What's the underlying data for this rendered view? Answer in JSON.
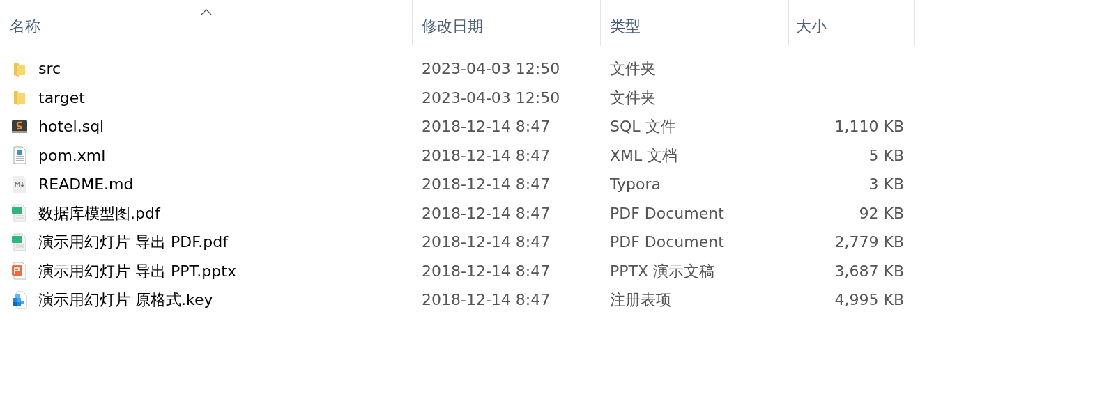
{
  "columns": [
    {
      "label": "名称",
      "sorted": true
    },
    {
      "label": "修改日期",
      "sorted": false
    },
    {
      "label": "类型",
      "sorted": false
    },
    {
      "label": "大小",
      "sorted": false
    }
  ],
  "rows": [
    {
      "kind": "folder",
      "name": "src",
      "modified": "2023-04-03 12:50",
      "type": "文件夹"
    },
    {
      "kind": "folder",
      "name": "target",
      "modified": "2023-04-03 12:50",
      "type": "文件夹"
    },
    {
      "kind": "sql",
      "name": "hotel.sql",
      "modified": "2018-12-14 8:47",
      "type": "SQL 文件",
      "size": "1,110 KB"
    },
    {
      "kind": "xml",
      "name": "pom.xml",
      "modified": "2018-12-14 8:47",
      "type": "XML 文档",
      "size": "5 KB"
    },
    {
      "kind": "md",
      "name": "README.md",
      "modified": "2018-12-14 8:47",
      "type": "Typora",
      "size": "3 KB"
    },
    {
      "kind": "pdf",
      "name": "数据库模型图.pdf",
      "modified": "2018-12-14 8:47",
      "type": "PDF Document",
      "size": "92 KB"
    },
    {
      "kind": "pdf",
      "name": "演示用幻灯片 导出 PDF.pdf",
      "modified": "2018-12-14 8:47",
      "type": "PDF Document",
      "size": "2,779 KB"
    },
    {
      "kind": "pptx",
      "name": "演示用幻灯片 导出 PPT.pptx",
      "modified": "2018-12-14 8:47",
      "type": "PPTX 演示文稿",
      "size": "3,687 KB"
    },
    {
      "kind": "reg",
      "name": "演示用幻灯片 原格式.key",
      "modified": "2018-12-14 8:47",
      "type": "注册表项",
      "size": "4,995 KB"
    }
  ]
}
